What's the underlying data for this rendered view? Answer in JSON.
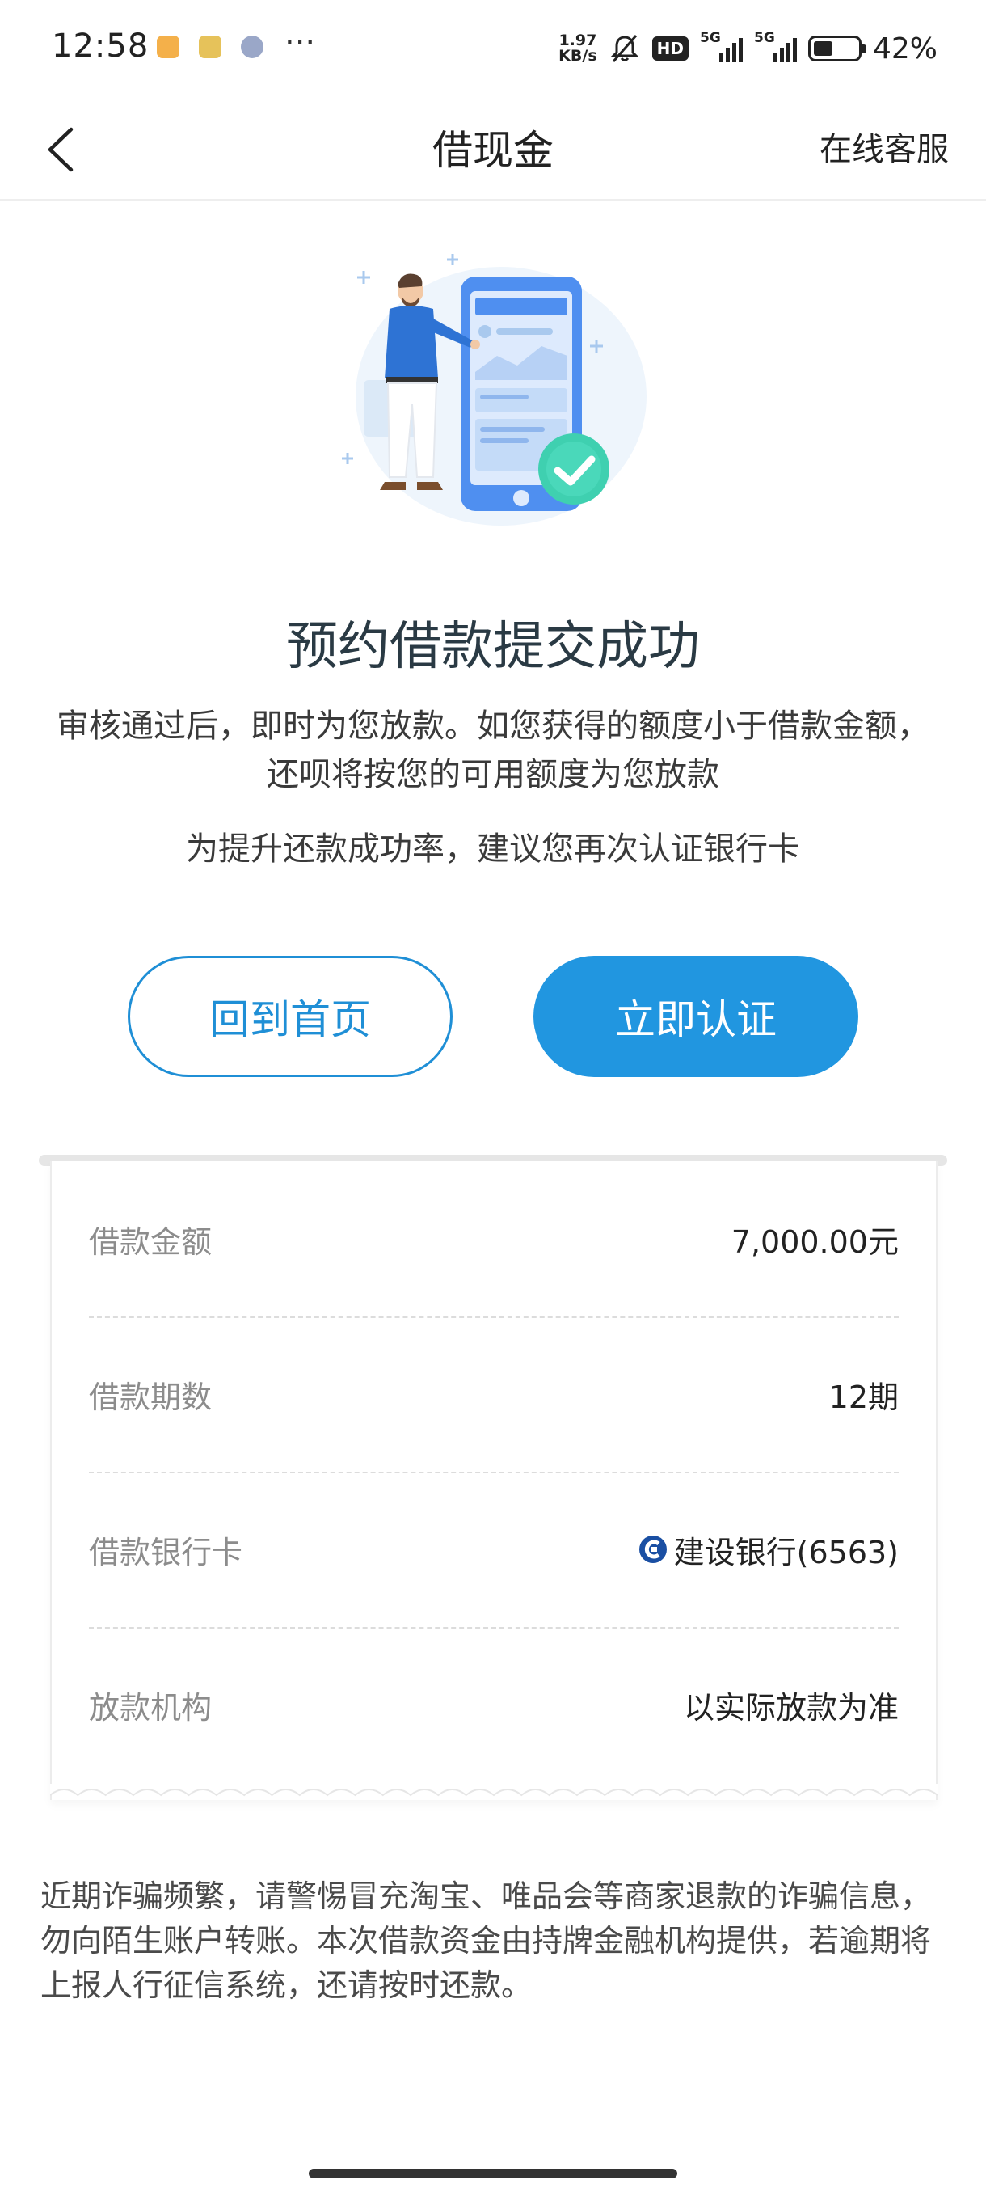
{
  "status_bar": {
    "time": "12:58",
    "net_speed_value": "1.97",
    "net_speed_unit": "KB/s",
    "hd_label": "HD",
    "signal1_label": "5G",
    "signal2_label": "5G",
    "battery_level_percent": 42,
    "battery_text": "42%",
    "more_dots": "···"
  },
  "nav": {
    "title": "借现金",
    "customer_service": "在线客服"
  },
  "result": {
    "title": "预约借款提交成功",
    "description": "审核通过后，即时为您放款。如您获得的额度小于借款金额，还呗将按您的可用额度为您放款",
    "suggestion": "为提升还款成功率，建议您再次认证银行卡"
  },
  "buttons": {
    "home": "回到首页",
    "verify": "立即认证"
  },
  "details": [
    {
      "label": "借款金额",
      "value": "7,000.00元"
    },
    {
      "label": "借款期数",
      "value": "12期"
    },
    {
      "label": "借款银行卡",
      "value": "建设银行(6563)",
      "icon": "ccb-bank-logo-icon"
    },
    {
      "label": "放款机构",
      "value": "以实际放款为准"
    }
  ],
  "notice": "近期诈骗频繁，请警惕冒充淘宝、唯品会等商家退款的诈骗信息，勿向陌生账户转账。本次借款资金由持牌金融机构提供，若逾期将上报人行征信系统，还请按时还款。",
  "colors": {
    "accent": "#2196e0",
    "accent_border": "#1f8fd6",
    "title": "#2a3a44",
    "label_gray": "#8c8c8c",
    "success_check": "#3fd0b0"
  }
}
